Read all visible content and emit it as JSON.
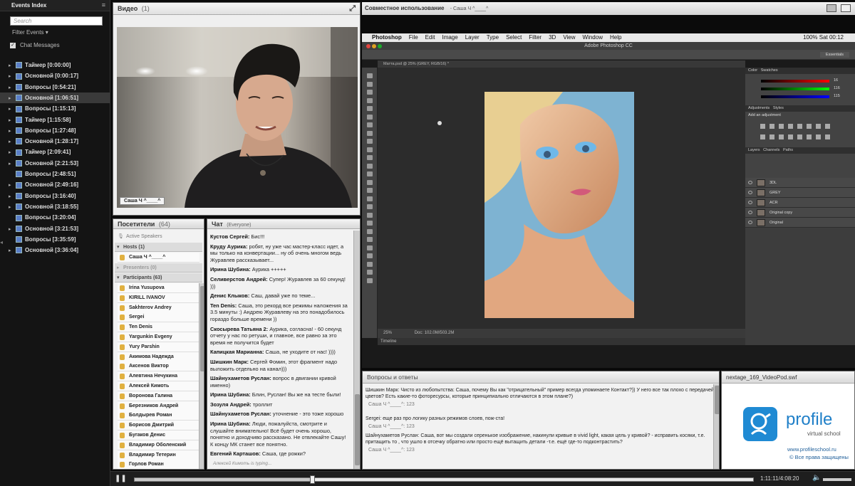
{
  "events_index": {
    "title": "Events Index",
    "search_placeholder": "Search",
    "filter_label": "Filter Events",
    "chat_messages_label": "Chat Messages",
    "items": [
      {
        "label": "Таймер [0:00:00]",
        "selected": false,
        "expand": true
      },
      {
        "label": "Основной [0:00:17]",
        "selected": false,
        "expand": true
      },
      {
        "label": "Вопросы [0:54:21]",
        "selected": false,
        "expand": true
      },
      {
        "label": "Основной [1:06:51]",
        "selected": true,
        "expand": true
      },
      {
        "label": "Вопросы [1:15:13]",
        "selected": false,
        "expand": true
      },
      {
        "label": "Таймер [1:15:58]",
        "selected": false,
        "expand": true
      },
      {
        "label": "Вопросы [1:27:48]",
        "selected": false,
        "expand": true
      },
      {
        "label": "Основной [1:28:17]",
        "selected": false,
        "expand": true
      },
      {
        "label": "Таймер [2:09:41]",
        "selected": false,
        "expand": true
      },
      {
        "label": "Основной [2:21:53]",
        "selected": false,
        "expand": true
      },
      {
        "label": "Вопросы [2:48:51]",
        "selected": false,
        "expand": false
      },
      {
        "label": "Основной [2:49:16]",
        "selected": false,
        "expand": true
      },
      {
        "label": "Вопросы [3:16:40]",
        "selected": false,
        "expand": true
      },
      {
        "label": "Основной [3:18:55]",
        "selected": false,
        "expand": true
      },
      {
        "label": "Вопросы [3:20:04]",
        "selected": false,
        "expand": false
      },
      {
        "label": "Основной [3:21:53]",
        "selected": false,
        "expand": true
      },
      {
        "label": "Вопросы [3:35:59]",
        "selected": false,
        "expand": false
      },
      {
        "label": "Основной [3:36:04]",
        "selected": false,
        "expand": true
      }
    ]
  },
  "video": {
    "title": "Видео",
    "count": "(1)",
    "name_tag": "Саша Ч ^____^"
  },
  "attendees": {
    "title": "Посетители",
    "count": "(64)",
    "active_speakers": "Active Speakers",
    "hosts_label": "Hosts (1)",
    "host_name": "Саша Ч ^____^",
    "presenters_label": "Presenters (0)",
    "participants_label": "Participants (63)",
    "participants": [
      "Irina Yusupova",
      "KIRILL IVANOV",
      "Sakhterov Andrey",
      "Sergei",
      "Ten Denis",
      "Yargunkin Evgeny",
      "Yury Parshin",
      "Акимова Надежда",
      "Аксенов Виктор",
      "Алевтина Нечукина",
      "Алексей Кимоть",
      "Воронова Галина",
      "Березников Андрей",
      "Болдырев Роман",
      "Борисов Дмитрий",
      "Бугаков Денис",
      "Владимир Оболенский",
      "Владимир Тетерин",
      "Горлов Роман"
    ]
  },
  "chat": {
    "title": "Чат",
    "scope": "(Everyone)",
    "messages": [
      {
        "author": "Кустов Сергей:",
        "text": "Бис!!!"
      },
      {
        "author": "Круду Аурика:",
        "text": "робят, ну уже час мастер-класс идет, а мы только на конвертации... ну об очень многом ведь Журавлев  рассказывает..."
      },
      {
        "author": "Ирина Шубина:",
        "text": "Аурика +++++"
      },
      {
        "author": "Селиверстов Андрей:",
        "text": "Супер! Журавлев за 60 секунд! )))"
      },
      {
        "author": "Денис Клыков:",
        "text": "Саш, давай уже по теме..."
      },
      {
        "author": "Ten Denis:",
        "text": "Саша, это рекорд все режимы наложения за 3.5 минуты :) Андрею Журавлеву на это понадобилось гораздо больше времени ))"
      },
      {
        "author": "Скосырева Татьяна 2:",
        "text": "Аурика, согласна! - 60 секунд отчету у нас по ретуши, и главное, все равно за это время не получится будет"
      },
      {
        "author": "Капицкая Марианна:",
        "text": "Саша, не уходите от нас! ))))"
      },
      {
        "author": "Шишкин Марк:",
        "text": "Сергей Фомин, этот фрагмент надо выложить отдельно на канал)))"
      },
      {
        "author": "Шайнухаметов Руслан:",
        "text": "вопрос в двигании кривой именно)"
      },
      {
        "author": "Ирина Шубина:",
        "text": "Блин, Руслан! Вы же на тесте были!"
      },
      {
        "author": "Зозуля Андрей:",
        "text": "троллит"
      },
      {
        "author": "Шайнухаметов Руслан:",
        "text": "уточнение - это тоже хорошо"
      },
      {
        "author": "Ирина Шубина:",
        "text": "Люди, пожалуйста, смотрите и слушайте внимательно! Всё будет очень хорошо, понятно и доходчиво рассказано. Не отвлекайте Сашу! К концу МК станет все понятно."
      },
      {
        "author": "Евгений Карташов:",
        "text": "Саша, где рожки?"
      }
    ],
    "typing": "Алексей Кимоть is typing..."
  },
  "share": {
    "title": "Совместное использование",
    "presenter": "- Саша Ч ^____^",
    "mac_menu": [
      "Photoshop",
      "File",
      "Edit",
      "Image",
      "Layer",
      "Type",
      "Select",
      "Filter",
      "3D",
      "View",
      "Window",
      "Help"
    ],
    "mac_status": "100%  Sat 00:12",
    "app_title": "Adobe Photoshop CC",
    "doc_tab": "Матта.psd @ 25% (GREY, RGB/16) *",
    "zoom": "25%",
    "doc_info": "Doc: 102.0M/503.2M",
    "timeline_label": "Timeline",
    "essentials": "Essentials",
    "panel_color": "Color",
    "panel_swatches": "Swatches",
    "panel_adjustments": "Adjustments",
    "panel_styles": "Styles",
    "add_adjustment": "Add an adjustment",
    "panel_layers": "Layers",
    "panel_channels": "Channels",
    "panel_paths": "Paths",
    "color_values": [
      "16",
      "116",
      "115"
    ],
    "layers": [
      "3DL",
      "GREY",
      "ACR",
      "Original copy",
      "Original"
    ]
  },
  "qa": {
    "title": "Вопросы и ответы",
    "items": [
      {
        "q": "Шишкин Марк: Чисто из любопытства: Саша, почему Вы как \"отрицательный\" пример всегда упоминаете Контакт?)) У него все так плохо с передачей цветов? Есть какие-то фоторесурсы, которые принципиально отличаются в этом плане?)",
        "a": "Саша Ч ^____^: 123"
      },
      {
        "q": "Sergei: еще раз про логику разных режимов слоев, пож-ста!",
        "a": "Саша Ч ^____^: 123"
      },
      {
        "q": "Шайнухаметов Руслан: Саша, вот мы создали серенькое изображение, накинули кривые в vivid light, какая цель у кривой? - исправить косяки, т.е. притащить то , что ушло в отсечку обратно или просто ещё вытащить детали -т.е. ещё где-то подконтрастить?",
        "a": "Саша Ч ^____^: 123"
      }
    ]
  },
  "nextage": {
    "title": "nextage_169_VideoPod.swf",
    "brand": "profile",
    "brand_sub": "virtual school",
    "url": "www.profileschool.ru",
    "rights": "© Все права защищены"
  },
  "player": {
    "time": "1:11:11/4:08:20",
    "progress": 0.287
  },
  "colors": {
    "brand_blue": "#1f8ad3",
    "ps_bg": "#2c2c2c",
    "photo_bg": "#7eb3d2"
  }
}
